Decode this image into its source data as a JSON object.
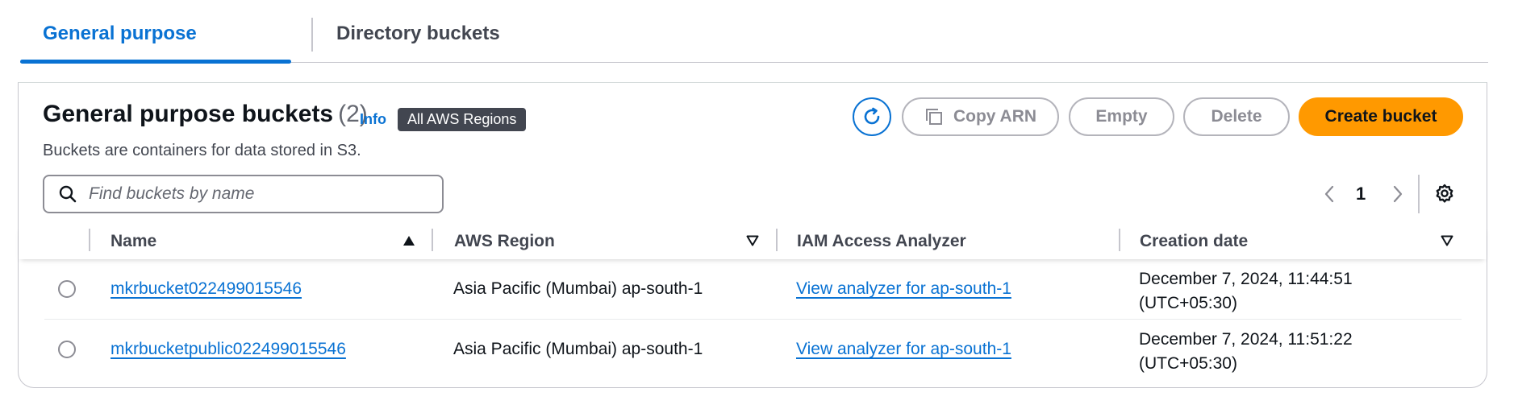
{
  "tabs": {
    "general": "General purpose buckets",
    "directory": "Directory buckets"
  },
  "header": {
    "title": "General purpose buckets",
    "count": "(2)",
    "info": "Info",
    "region_badge": "All AWS Regions",
    "description": "Buckets are containers for data stored in S3."
  },
  "toolbar": {
    "refresh_icon": "refresh-icon",
    "copy_arn": "Copy ARN",
    "empty": "Empty",
    "delete": "Delete",
    "create_bucket": "Create bucket"
  },
  "search": {
    "placeholder": "Find buckets by name",
    "value": ""
  },
  "pagination": {
    "current_page": "1"
  },
  "table": {
    "columns": [
      "Name",
      "AWS Region",
      "IAM Access Analyzer",
      "Creation date"
    ],
    "rows": [
      {
        "name": "mkrbucket022499015546",
        "region": "Asia Pacific (Mumbai) ap-south-1",
        "analyzer": "View analyzer for ap-south-1",
        "date_line1": "December 7, 2024, 11:44:51",
        "date_line2": "(UTC+05:30)"
      },
      {
        "name": "mkrbucketpublic022499015546",
        "region": "Asia Pacific (Mumbai) ap-south-1",
        "analyzer": "View analyzer for ap-south-1",
        "date_line1": "December 7, 2024, 11:51:22",
        "date_line2": "(UTC+05:30)"
      }
    ]
  },
  "colors": {
    "link": "#0972d3",
    "primary_button": "#ff9900",
    "badge_bg": "#424650"
  }
}
